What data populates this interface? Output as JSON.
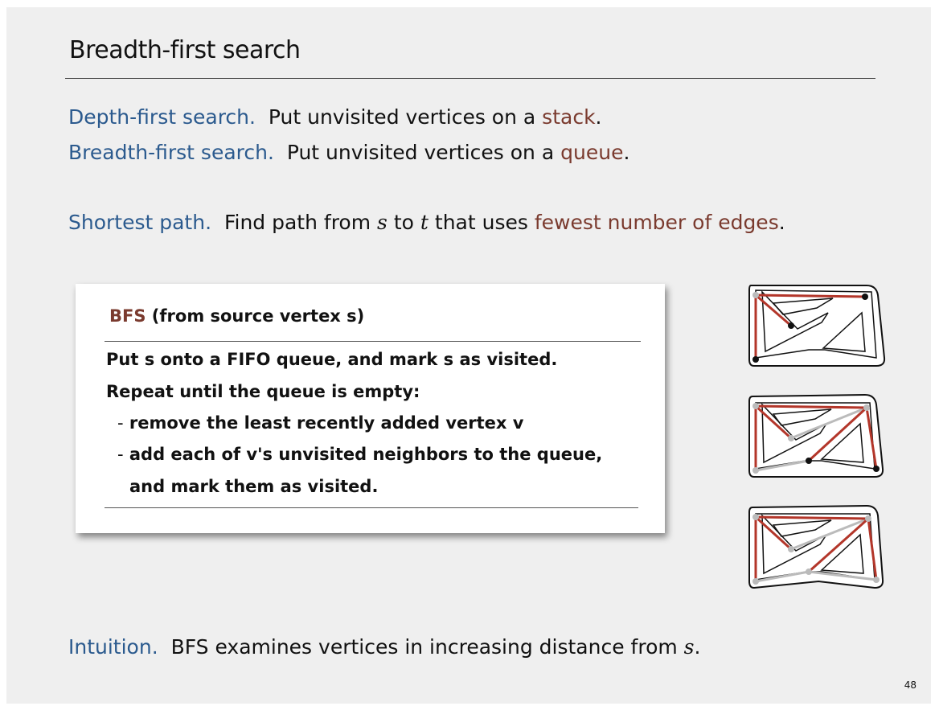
{
  "title": "Breadth-first search",
  "lines": [
    {
      "term": "Depth-first search.",
      "text": "Put unvisited vertices on a",
      "highlight": "stack",
      "end": "."
    },
    {
      "term": "Breadth-first search.",
      "text": "Put unvisited vertices on a",
      "highlight": "queue",
      "end": "."
    }
  ],
  "shortest": {
    "term": "Shortest path.",
    "text1": "Find path from",
    "s": "s",
    "to": "to",
    "t": "t",
    "text2": "that uses",
    "highlight": "fewest number of edges",
    "end": "."
  },
  "box": {
    "title_bfs": "BFS",
    "title_rest": "(from source vertex s)",
    "dash": "-",
    "steps": [
      "Put s onto a FIFO queue, and mark s as visited.",
      "Repeat until the queue is empty:",
      "remove the least recently added vertex v",
      "add each of v's unvisited neighbors to the queue,",
      "and mark them as visited."
    ]
  },
  "intuition": {
    "term": "Intuition.",
    "text": "BFS examines vertices in increasing distance from",
    "s": "s",
    "end": "."
  },
  "page_number": "48",
  "colors": {
    "keyword_blue": "#2b5a8e",
    "highlight_red": "#7a3a2e",
    "edge_red": "#b3362a",
    "visited_gray": "#bbbbbb"
  }
}
